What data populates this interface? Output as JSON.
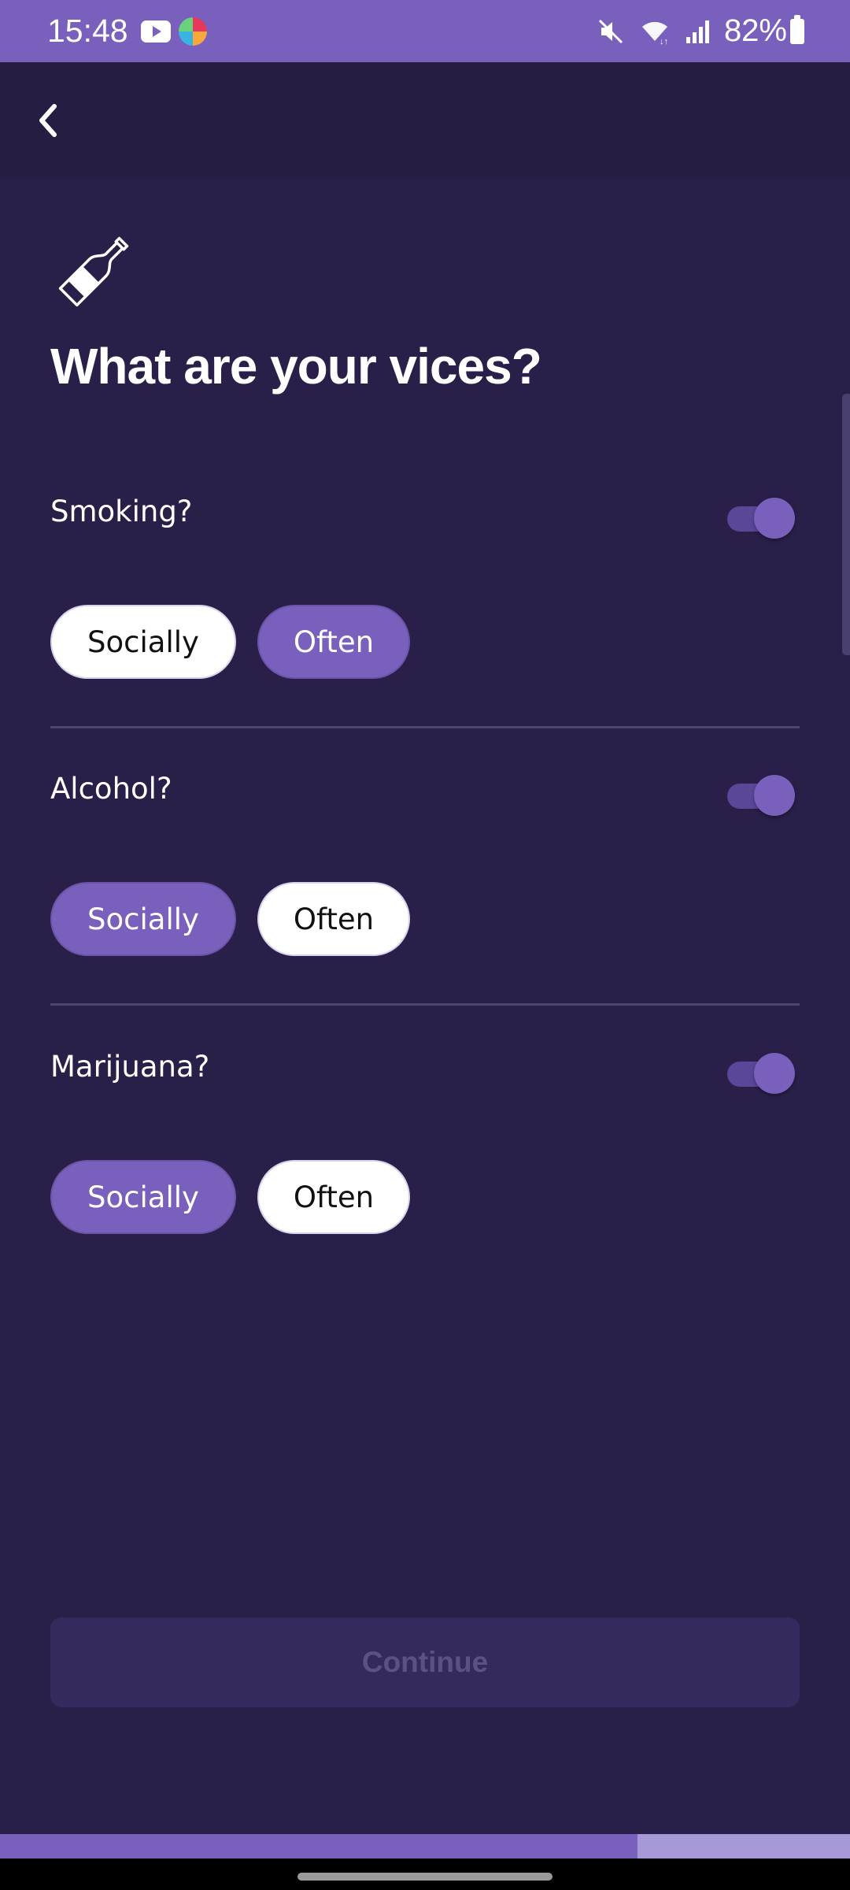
{
  "status_bar": {
    "time": "15:48",
    "battery_percent": "82%",
    "icons": [
      "youtube-icon",
      "app-notification-icon",
      "mute-icon",
      "wifi-icon",
      "signal-icon",
      "battery-icon"
    ]
  },
  "header": {
    "back_icon": "chevron-left-icon"
  },
  "page": {
    "icon": "bottle-icon",
    "title": "What are your vices?"
  },
  "vices": [
    {
      "label": "Smoking?",
      "enabled": true,
      "options": [
        "Socially",
        "Often"
      ],
      "selected": "Often"
    },
    {
      "label": "Alcohol?",
      "enabled": true,
      "options": [
        "Socially",
        "Often"
      ],
      "selected": "Socially"
    },
    {
      "label": "Marijuana?",
      "enabled": true,
      "options": [
        "Socially",
        "Often"
      ],
      "selected": "Socially"
    }
  ],
  "footer": {
    "continue_label": "Continue",
    "continue_enabled": false
  },
  "progress": {
    "fraction": 0.75
  },
  "colors": {
    "background": "#291f48",
    "accent": "#7860bc",
    "chip_unselected": "#ffffff",
    "disabled_button": "#352a5e"
  }
}
